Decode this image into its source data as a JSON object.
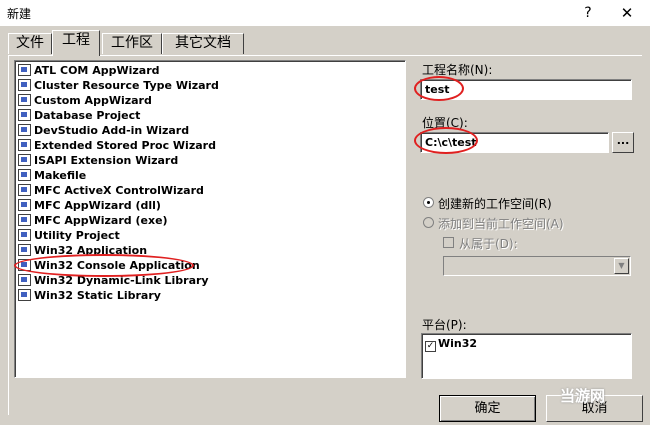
{
  "window": {
    "title": "新建",
    "help_glyph": "?",
    "close_glyph": "✕"
  },
  "tabs": [
    {
      "label": "文件",
      "active": false
    },
    {
      "label": "工程",
      "active": true
    },
    {
      "label": "工作区",
      "active": false
    },
    {
      "label": "其它文档",
      "active": false
    }
  ],
  "project_types": [
    "ATL COM AppWizard",
    "Cluster Resource Type Wizard",
    "Custom AppWizard",
    "Database Project",
    "DevStudio Add-in Wizard",
    "Extended Stored Proc Wizard",
    "ISAPI Extension Wizard",
    "Makefile",
    "MFC ActiveX ControlWizard",
    "MFC AppWizard (dll)",
    "MFC AppWizard (exe)",
    "Utility Project",
    "Win32 Application",
    "Win32 Console Application",
    "Win32 Dynamic-Link Library",
    "Win32 Static Library"
  ],
  "selected_project_type": "Win32 Console Application",
  "project_name": {
    "label": "工程名称(N):",
    "value": "test"
  },
  "location": {
    "label": "位置(C):",
    "value": "C:\\c\\test",
    "browse_label": "..."
  },
  "workspace_options": {
    "create_new": "创建新的工作空间(R)",
    "add_to_current": "添加到当前工作空间(A)",
    "dependency_of": "从属于(D):",
    "selected": "create_new"
  },
  "platforms": {
    "label": "平台(P):",
    "items": [
      {
        "name": "Win32",
        "checked": true,
        "check_glyph": "✓"
      }
    ]
  },
  "buttons": {
    "ok": "确定",
    "cancel": "取消"
  },
  "watermark": "当游网",
  "highlight_color": "#e02020"
}
